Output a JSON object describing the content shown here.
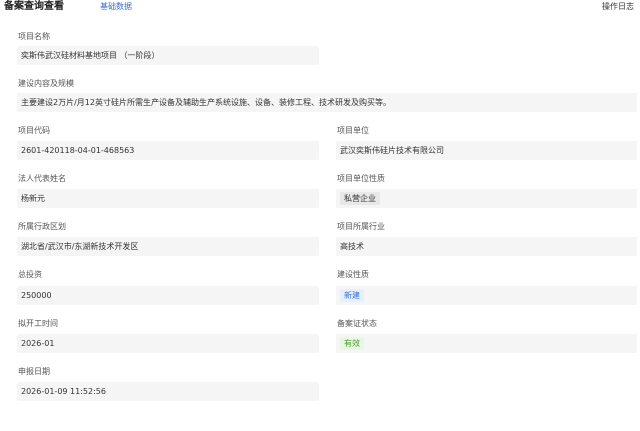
{
  "header": {
    "title": "备案查询查看",
    "tab_basic": "基础数据",
    "op_log": "操作日志"
  },
  "fields": {
    "project_name": {
      "label": "项目名称",
      "value": "奕斯伟武汉硅材料基地项目 （一阶段）"
    },
    "content_scale": {
      "label": "建设内容及规模",
      "value": "主要建设2万片/月12英寸硅片所需生产设备及辅助生产系统设施、设备、装修工程、技术研发及购买等。"
    },
    "project_code": {
      "label": "项目代码",
      "value": "2601-420118-04-01-468563"
    },
    "project_unit": {
      "label": "项目单位",
      "value": "武汉奕斯伟硅片技术有限公司"
    },
    "legal_rep": {
      "label": "法人代表姓名",
      "value": "杨新元"
    },
    "unit_nature": {
      "label": "项目单位性质",
      "value": "私营企业"
    },
    "admin_region": {
      "label": "所属行政区划",
      "value": "湖北省/武汉市/东湖新技术开发区"
    },
    "industry": {
      "label": "项目所属行业",
      "value": "高技术"
    },
    "total_investment": {
      "label": "总投资",
      "value": "250000"
    },
    "construction_nature": {
      "label": "建设性质",
      "value": "新建"
    },
    "planned_start": {
      "label": "拟开工时间",
      "value": "2026-01"
    },
    "cert_status": {
      "label": "备案证状态",
      "value": "有效"
    },
    "apply_date": {
      "label": "申报日期",
      "value": "2026-01-09 11:52:56"
    }
  },
  "colors": {
    "accent": "#3a6fc4",
    "field_bg": "#f5f5f5",
    "status_green": "#4a9b2f"
  }
}
